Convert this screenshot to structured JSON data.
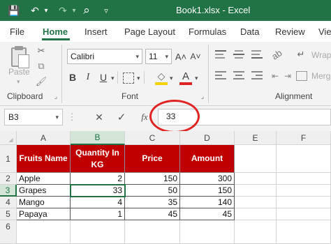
{
  "window": {
    "title": "Book1.xlsx  -  Excel"
  },
  "quick_access": [
    {
      "name": "save-icon",
      "glyph": "💾"
    },
    {
      "name": "undo-icon",
      "glyph": "↶"
    },
    {
      "name": "undo-dropdown-icon",
      "glyph": "▾"
    },
    {
      "name": "redo-icon",
      "glyph": "↷"
    },
    {
      "name": "redo-dropdown-icon",
      "glyph": "▾"
    },
    {
      "name": "search-icon",
      "glyph": "⌕"
    },
    {
      "name": "customize-icon",
      "glyph": "▿"
    }
  ],
  "tabs": [
    "File",
    "Home",
    "Insert",
    "Page Layout",
    "Formulas",
    "Data",
    "Review",
    "View"
  ],
  "active_tab": "Home",
  "ribbon": {
    "paste_label": "Paste",
    "clipboard_label": "Clipboard",
    "font_name": "Calibri",
    "font_size": "11",
    "font_label": "Font",
    "alignment_label": "Alignment",
    "wrap_label": "Wrap",
    "merge_label": "Merge",
    "bold": "B",
    "italic": "I",
    "underline": "U",
    "grow_font": "A˄",
    "shrink_font": "A˅",
    "font_color_glyph": "A",
    "accent_red": "#e02424",
    "accent_yellow": "#f6d000"
  },
  "formula_bar": {
    "name_box": "B3",
    "cancel_glyph": "✕",
    "enter_glyph": "✓",
    "fx_glyph": "fx",
    "value": "33"
  },
  "grid": {
    "columns": [
      "A",
      "B",
      "C",
      "D",
      "E",
      "F"
    ],
    "selected_column": "B",
    "rows": [
      "1",
      "2",
      "3",
      "4",
      "5",
      "6"
    ],
    "selected_row": "3",
    "headers": [
      "Fruits Name",
      "Quantity In KG",
      "Price",
      "Amount"
    ],
    "data": [
      [
        "Apple",
        "2",
        "150",
        "300"
      ],
      [
        "Grapes",
        "33",
        "50",
        "150"
      ],
      [
        "Mango",
        "4",
        "35",
        "140"
      ],
      [
        "Papaya",
        "1",
        "45",
        "45"
      ]
    ]
  },
  "colors": {
    "excel_green": "#217346",
    "header_red": "#c00000",
    "annotation_red": "#e02424"
  }
}
